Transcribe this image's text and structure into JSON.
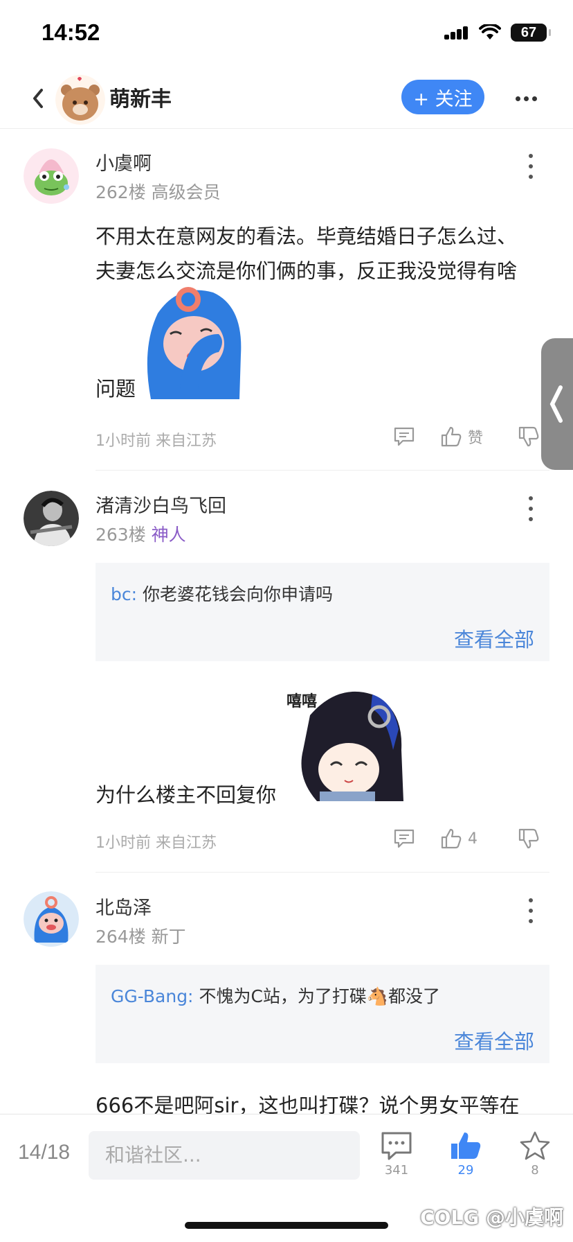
{
  "status": {
    "time": "14:52",
    "battery": "67"
  },
  "nav": {
    "title": "萌新丰",
    "follow_label": "+ 关注"
  },
  "posts": [
    {
      "author": "小虞啊",
      "floor": "262楼",
      "rank": "高级会员",
      "text_line1": "不用太在意网友的看法。毕竟结婚日子怎么过、",
      "text_line2": "夫妻怎么交流是你们俩的事，反正我没觉得有啥",
      "text_line3": "问题",
      "time": "1小时前 来自江苏",
      "like_label": "赞"
    },
    {
      "author": "渚清沙白鸟飞回",
      "floor": "263楼",
      "rank": "神人",
      "quote_user": "bc:",
      "quote_text": "你老婆花钱会向你申请吗",
      "quote_more": "查看全部",
      "sticker_text": "嘻嘻",
      "text": "为什么楼主不回复你",
      "time": "1小时前 来自江苏",
      "like_count": "4"
    },
    {
      "author": "北岛泽",
      "floor": "264楼",
      "rank": "新丁",
      "quote_user": "GG-Bang:",
      "quote_text_before": "不愧为C站，为了打碟",
      "quote_emoji": "🐴",
      "quote_text_after": "都没了",
      "quote_more": "查看全部",
      "text": "666不是吧阿sir，这也叫打碟？说个男女平等在"
    }
  ],
  "bottom": {
    "page": "14/18",
    "input_placeholder": "和谐社区...",
    "comments": "341",
    "likes": "29",
    "favorites": "8"
  },
  "watermark": "COLG @小虞啊"
}
